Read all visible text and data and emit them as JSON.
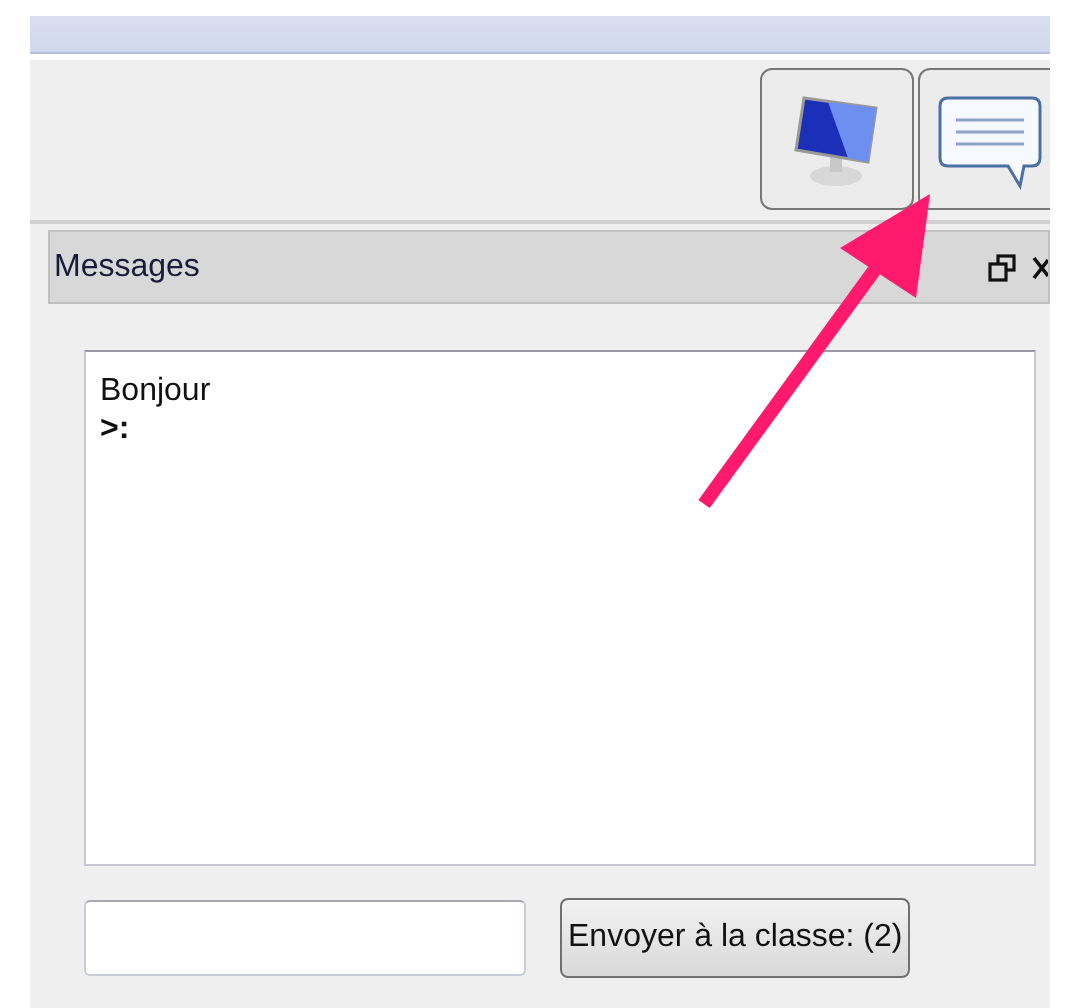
{
  "toolbar": {
    "buttons": [
      {
        "kind": "monitor"
      },
      {
        "kind": "chat"
      }
    ]
  },
  "panel": {
    "title": "Messages"
  },
  "messages": [
    {
      "kind": "text",
      "text": "Bonjour"
    },
    {
      "kind": "prompt",
      "text": ">:"
    }
  ],
  "send_button": {
    "label": "Envoyer à la classe: (2)"
  }
}
